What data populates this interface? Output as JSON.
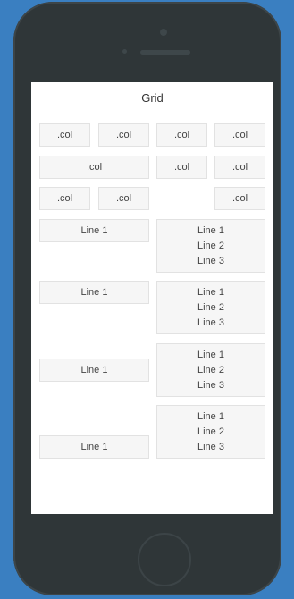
{
  "header": {
    "title": "Grid"
  },
  "rows": {
    "row1": [
      ".col",
      ".col",
      ".col",
      ".col"
    ],
    "row2": [
      ".col",
      ".col",
      ".col"
    ],
    "row3": [
      ".col",
      ".col",
      ".col"
    ],
    "line_rows": [
      {
        "left": "Line 1",
        "right": [
          "Line 1",
          "Line 2",
          "Line 3"
        ]
      },
      {
        "left": "Line 1",
        "right": [
          "Line 1",
          "Line 2",
          "Line 3"
        ]
      },
      {
        "left": "Line 1",
        "right": [
          "Line 1",
          "Line 2",
          "Line 3"
        ]
      },
      {
        "left": "Line 1",
        "right": [
          "Line 1",
          "Line 2",
          "Line 3"
        ]
      }
    ]
  }
}
